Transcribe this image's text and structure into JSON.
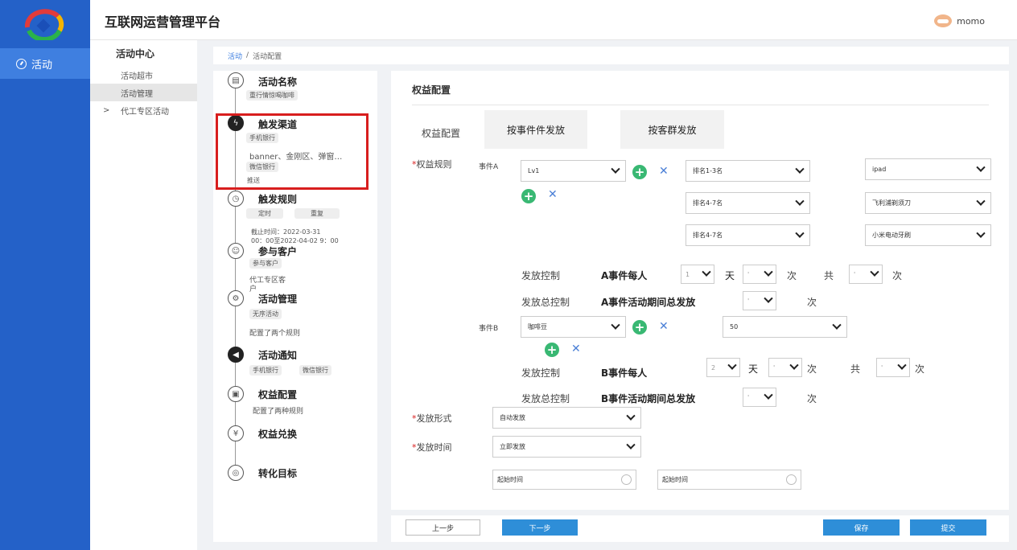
{
  "header": {
    "title": "互联网运营管理平台",
    "user": "momo"
  },
  "nav": {
    "item": "活动"
  },
  "submenu": {
    "title": "活动中心",
    "items": [
      "活动超市",
      "活动管理",
      "代工专区活动"
    ],
    "expand": ">"
  },
  "breadcrumb": {
    "root": "活动",
    "sep": "/",
    "current": "活动配置"
  },
  "steps": [
    {
      "name": "活动名称",
      "tags": [
        "重行情惊喝咖啡"
      ],
      "texts": []
    },
    {
      "name": "触发渠道",
      "tags": [
        "手机银行",
        "微信银行"
      ],
      "texts": [
        "banner、金刚区、弹窗…",
        "推送"
      ]
    },
    {
      "name": "触发规则",
      "tags": [
        "定时",
        "重复"
      ],
      "texts": [
        "截止时间：2022-03-31",
        "00：00至2022-04-02 9：00"
      ]
    },
    {
      "name": "参与客户",
      "tags": [
        "参与客户"
      ],
      "texts": [
        "代工专区客",
        "户"
      ]
    },
    {
      "name": "活动管理",
      "tags": [
        "无序活动"
      ],
      "texts": [
        "配置了两个规则"
      ]
    },
    {
      "name": "活动通知",
      "tags": [
        "手机银行",
        "微信银行"
      ],
      "texts": []
    },
    {
      "name": "权益配置",
      "tags": [],
      "texts": [
        "配置了两种规则"
      ]
    },
    {
      "name": "权益兑换",
      "tags": [],
      "texts": []
    },
    {
      "name": "转化目标",
      "tags": [],
      "texts": []
    }
  ],
  "panel": {
    "title": "权益配置",
    "tabs": {
      "label": "权益配置",
      "tab1": "按事件件发放",
      "tab2": "按客群发放"
    },
    "rule_label": "权益规则",
    "event_a": {
      "label": "事件A",
      "level": "Lv1",
      "ranks": [
        "排名1-3名",
        "排名4-7名",
        "排名4-7名"
      ],
      "prizes": [
        "ipad",
        "飞利浦剃须刀",
        "小米电动牙刷"
      ]
    },
    "control_a": {
      "label": "发放控制",
      "each": "A事件每人",
      "v1": "1",
      "day": "天",
      "v2": "'",
      "times": "次",
      "total": "共",
      "v3": "'",
      "times2": "次"
    },
    "total_a": {
      "label": "发放总控制",
      "text": "A事件活动期间总发放",
      "v": "'",
      "times": "次"
    },
    "event_b": {
      "label": "事件B",
      "item": "咖啡豆",
      "count": "50"
    },
    "control_b": {
      "label": "发放控制",
      "each": "B事件每人",
      "v1": "2",
      "day": "天",
      "v2": "'",
      "times": "次",
      "total": "共",
      "v3": "'",
      "times2": "次"
    },
    "total_b": {
      "label": "发放总控制",
      "text": "B事件活动期间总发放",
      "v": "'",
      "times": "次"
    },
    "form_label": "发放形式",
    "form_value": "自动发放",
    "time_label": "发放时间",
    "time_value": "立即发放",
    "start1": "起始时间",
    "start2": "起始时间",
    "x": "✕",
    "plus": "+",
    "star": "*"
  },
  "footer": {
    "prev": "上一步",
    "next": "下一步",
    "save": "保存",
    "submit": "提交"
  }
}
